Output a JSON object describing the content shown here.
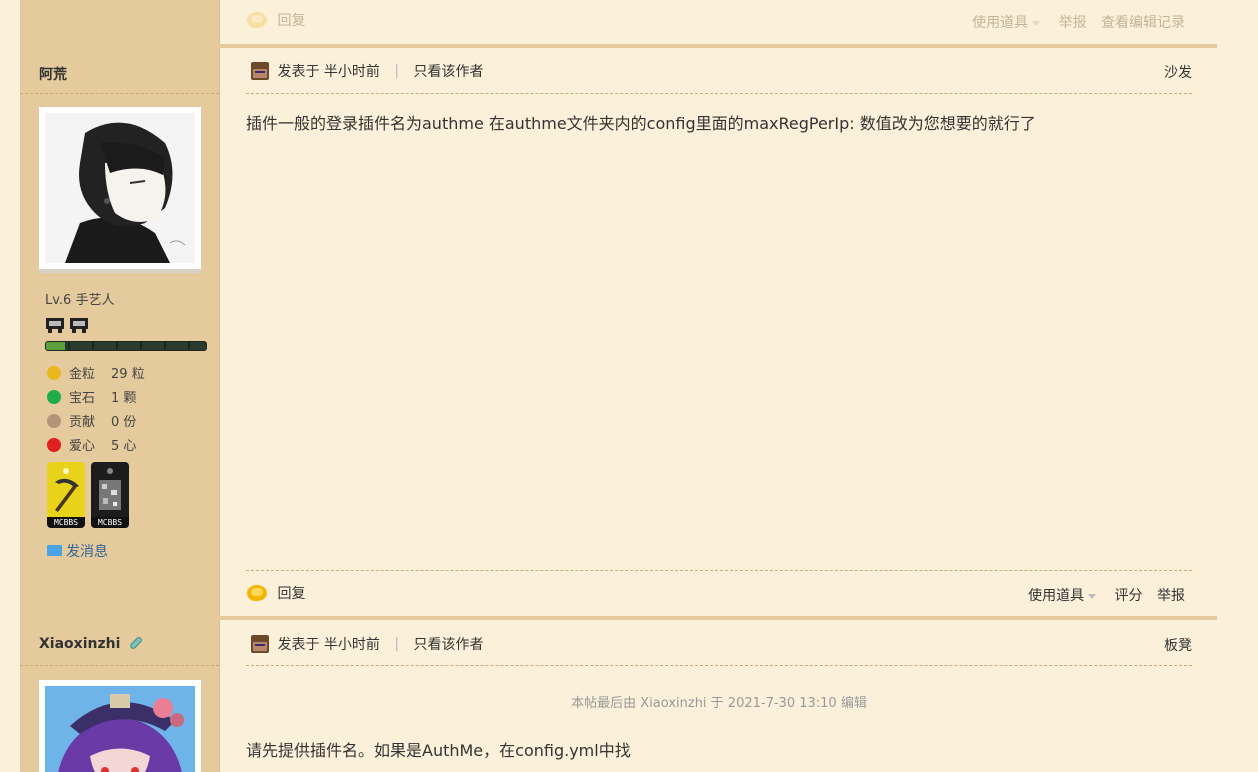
{
  "top_bar": {
    "reply_label": "回复",
    "actions": [
      "使用道具",
      "举报",
      "查看编辑记录"
    ]
  },
  "post1": {
    "author": "阿荒",
    "meta_posted": "发表于 半小时前",
    "meta_only_author": "只看该作者",
    "floor": "沙发",
    "level": "Lv.6 手艺人",
    "exp_progress": 0.12,
    "stats": [
      {
        "label": "金粒",
        "value": "29 粒",
        "icon": "gold-nugget-icon",
        "color": "#e8b820"
      },
      {
        "label": "宝石",
        "value": "1 颗",
        "icon": "emerald-icon",
        "color": "#1fae4a"
      },
      {
        "label": "贡献",
        "value": "0 份",
        "icon": "contribution-icon",
        "color": "#b59478"
      },
      {
        "label": "爱心",
        "value": "5 心",
        "icon": "heart-apple-icon",
        "color": "#e02020"
      }
    ],
    "medals": [
      "MCBBS",
      "MCBBS"
    ],
    "send_message": "发消息",
    "content": "插件一般的登录插件名为authme 在authme文件夹内的config里面的maxRegPerIp: 数值改为您想要的就行了",
    "reply_label": "回复",
    "actions": [
      "使用道具",
      "评分",
      "举报"
    ]
  },
  "post2": {
    "author": "Xiaoxinzhi",
    "meta_posted": "发表于 半小时前",
    "meta_only_author": "只看该作者",
    "floor": "板凳",
    "edit_note": "本帖最后由 Xiaoxinzhi 于 2021-7-30 13:10 编辑",
    "content": "请先提供插件名。如果是AuthMe，在config.yml中找"
  },
  "colors": {
    "sidebar": "#e4ca9c",
    "page": "#fbf1da",
    "link_blue": "#336699"
  }
}
